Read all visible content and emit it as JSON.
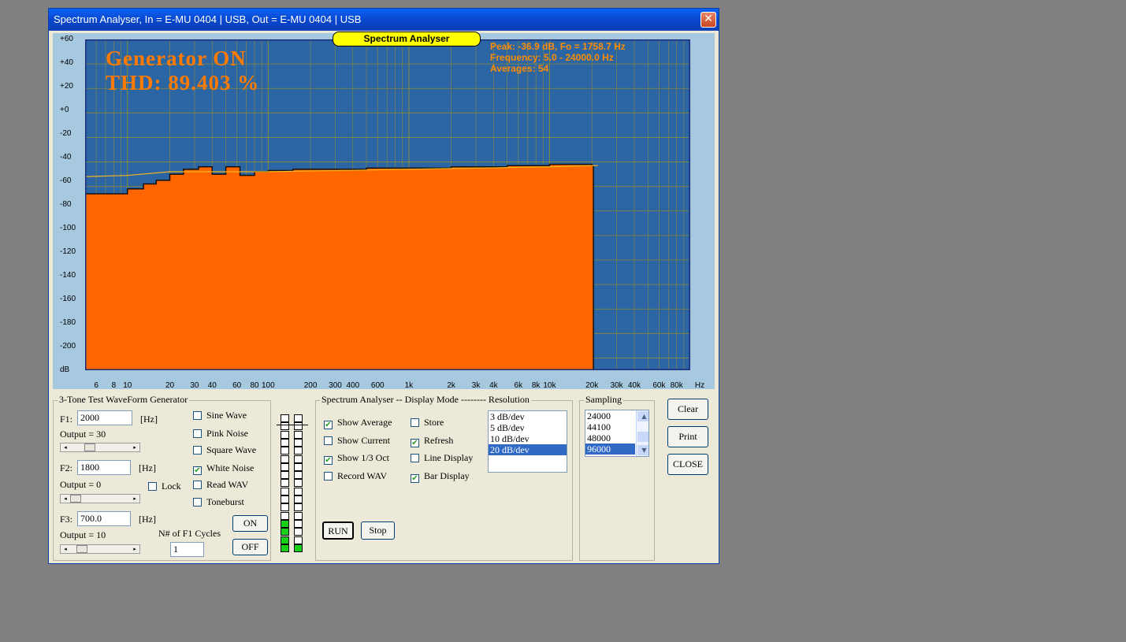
{
  "window": {
    "title": "Spectrum Analyser, In = E-MU 0404 | USB, Out = E-MU 0404 | USB",
    "close_glyph": "✕"
  },
  "plot": {
    "badge": "Spectrum Analyser",
    "generator_status": "Generator ON",
    "thd": "THD: 89.403 %",
    "peak": "Peak: -36.9 dB, Fo = 1758.7 Hz",
    "frequency": "Frequency: 5.0 - 24000.0 Hz",
    "averages": "Averages: 54",
    "y_ticks": [
      "+60",
      "+40",
      "+20",
      "+0",
      "-20",
      "-40",
      "-60",
      "-80",
      "-100",
      "-120",
      "-140",
      "-160",
      "-180",
      "-200",
      "dB"
    ],
    "x_ticks": [
      "6",
      "8",
      "10",
      "20",
      "30",
      "40",
      "60",
      "80",
      "100",
      "200",
      "300",
      "400",
      "600",
      "1k",
      "2k",
      "3k",
      "4k",
      "6k",
      "8k",
      "10k",
      "20k",
      "30k",
      "40k",
      "60k",
      "80k",
      "Hz"
    ],
    "colors": {
      "bg": "#2c65a4",
      "fill": "#ff6600",
      "grid": "#8a8a3a",
      "avg": "#111111",
      "current": "#f2b51f"
    }
  },
  "chart_data": {
    "type": "area",
    "xlabel": "Hz",
    "ylabel": "dB",
    "x_scale": "log",
    "xlim": [
      5,
      100000
    ],
    "ylim": [
      -210,
      60
    ],
    "series": [
      {
        "x": [
          5,
          10,
          13,
          16,
          20,
          25,
          32,
          40,
          50,
          63,
          80,
          100,
          150,
          200,
          300,
          500,
          1000,
          2000,
          5000,
          10000,
          15000,
          20000,
          20500
        ],
        "y": [
          -66,
          -62,
          -58,
          -55,
          -50,
          -46,
          -44,
          -50,
          -44,
          -51,
          -48,
          -47,
          -46,
          -46,
          -46,
          -45,
          -45,
          -44,
          -43,
          -42,
          -42,
          -43,
          -210
        ]
      },
      {
        "x": [
          5,
          10,
          20,
          40,
          100,
          1000,
          10000,
          20000,
          22000
        ],
        "y": [
          -52,
          -51,
          -48,
          -48,
          -48,
          -46,
          -44,
          -43,
          -43
        ]
      }
    ]
  },
  "generator": {
    "title": "3-Tone Test WaveForm Generator",
    "f1_label": "F1:",
    "f1_value": "2000",
    "f1_unit": "[Hz]",
    "f1_output": "Output = 30",
    "f2_label": "F2:",
    "f2_value": "1800",
    "f2_unit": "[Hz]",
    "f2_output": "Output = 0",
    "f3_label": "F3:",
    "f3_value": "700.0",
    "f3_unit": "[Hz]",
    "f3_output": "Output = 10",
    "lock": "Lock",
    "waves": [
      "Sine Wave",
      "Pink Noise",
      "Square Wave",
      "White Noise",
      "Read WAV",
      "Toneburst"
    ],
    "cycles_label": "N# of F1 Cycles",
    "cycles_value": "1",
    "on_label": "ON",
    "off_label": "OFF",
    "check_glyph": "✔"
  },
  "display_mode": {
    "title": "Spectrum Analyser -- Display Mode -------- Resolution",
    "options": [
      "Show Average",
      "Show Current",
      "Show 1/3 Oct",
      "Record WAV",
      "Store",
      "Refresh",
      "Line Display",
      "Bar Display"
    ],
    "resolution": [
      "3 dB/dev",
      "5 dB/dev",
      "10 dB/dev",
      "20 dB/dev"
    ],
    "run_label": "RUN",
    "stop_label": "Stop"
  },
  "sampling": {
    "title": "Sampling",
    "rates": [
      "24000",
      "44100",
      "48000",
      "96000"
    ]
  },
  "buttons": {
    "clear": "Clear",
    "print": "Print",
    "close": "CLOSE"
  },
  "meter": {
    "left_level": 0.25,
    "right_level": 0.05
  }
}
